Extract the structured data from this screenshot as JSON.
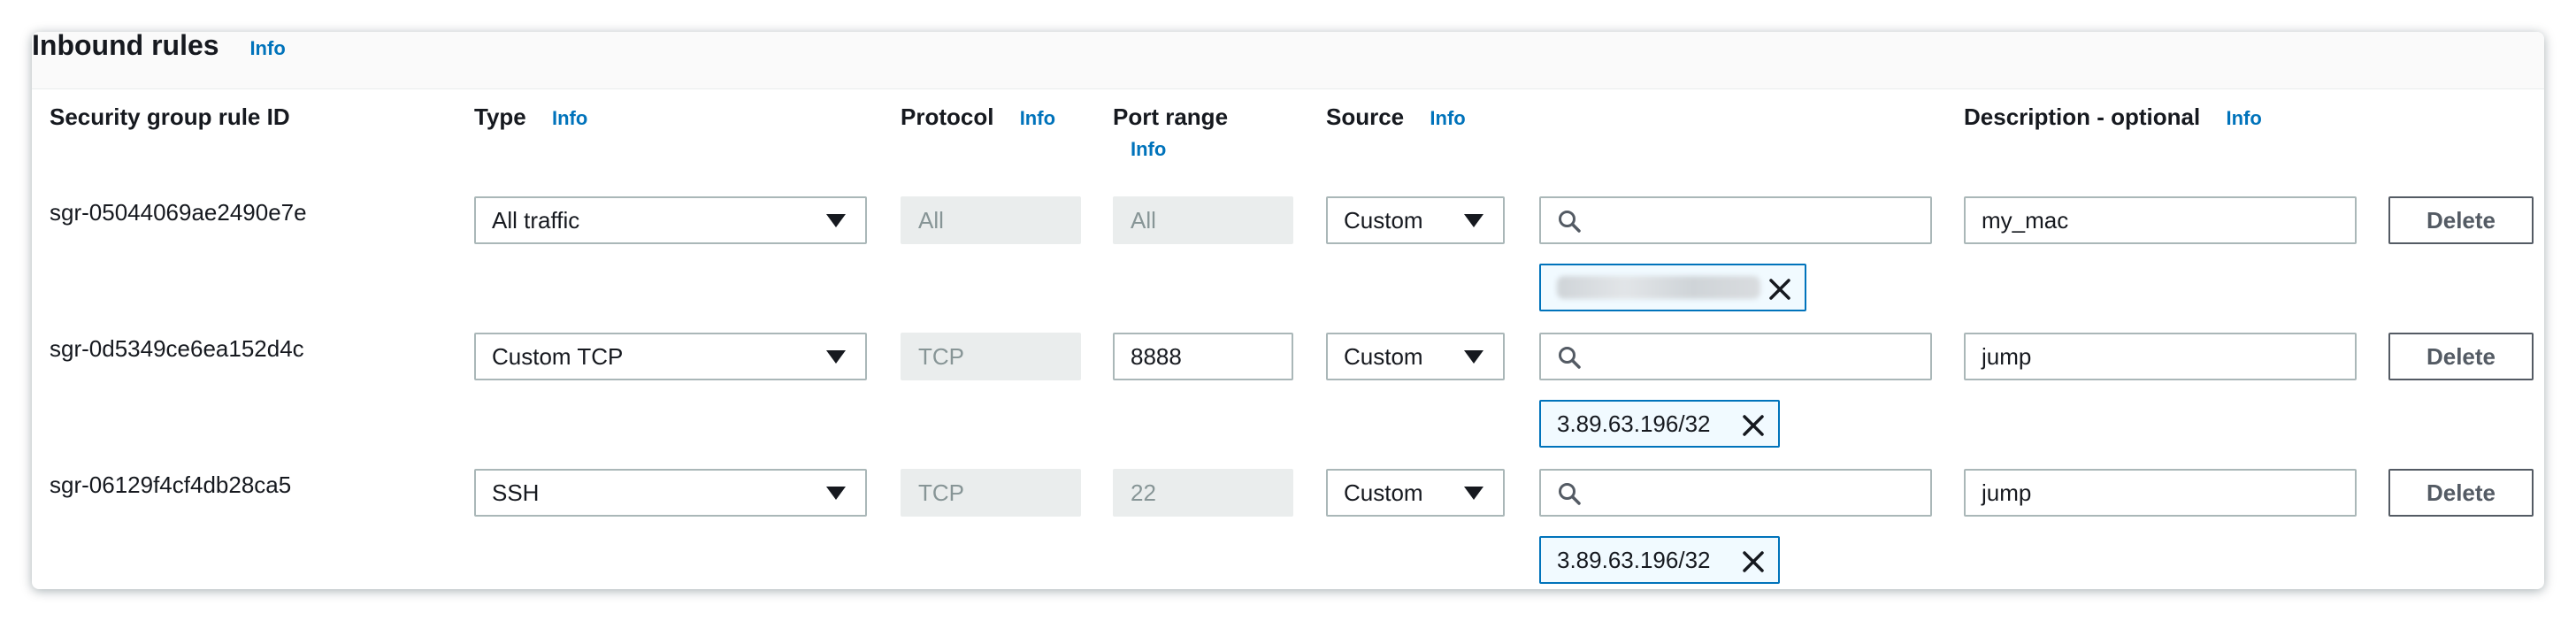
{
  "panel": {
    "title": "Inbound rules",
    "info": "Info"
  },
  "columns": {
    "rule_id": "Security group rule ID",
    "type": "Type",
    "protocol": "Protocol",
    "port_range": "Port range",
    "source": "Source",
    "description": "Description - optional",
    "info": "Info"
  },
  "rules": [
    {
      "id": "sgr-05044069ae2490e7e",
      "type": "All traffic",
      "protocol": "All",
      "port_range": "All",
      "port_editable": false,
      "source_type": "Custom",
      "search_value": "",
      "token": "",
      "token_redacted": true,
      "description": "my_mac",
      "delete": "Delete"
    },
    {
      "id": "sgr-0d5349ce6ea152d4c",
      "type": "Custom TCP",
      "protocol": "TCP",
      "port_range": "8888",
      "port_editable": true,
      "source_type": "Custom",
      "search_value": "",
      "token": "3.89.63.196/32",
      "token_redacted": false,
      "description": "jump",
      "delete": "Delete"
    },
    {
      "id": "sgr-06129f4cf4db28ca5",
      "type": "SSH",
      "protocol": "TCP",
      "port_range": "22",
      "port_editable": false,
      "source_type": "Custom",
      "search_value": "",
      "token": "3.89.63.196/32",
      "token_redacted": false,
      "description": "jump",
      "delete": "Delete"
    }
  ],
  "icons": {
    "search": "search-icon",
    "dropdown": "caret-down-icon",
    "remove": "close-icon"
  },
  "colors": {
    "link": "#0073bb",
    "token_border": "#0073bb",
    "token_bg": "#f1faff",
    "disabled_bg": "#eaeded"
  }
}
